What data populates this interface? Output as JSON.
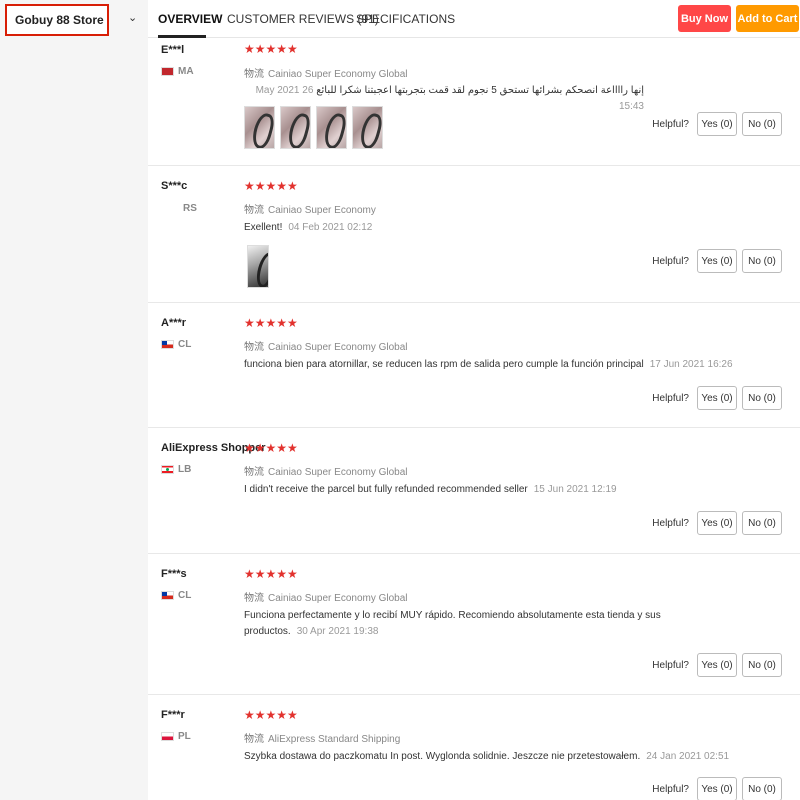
{
  "store": {
    "name": "Gobuy 88 Store",
    "chevron_icon": "chevron-down-icon"
  },
  "nav": {
    "tabs": [
      {
        "label": "OVERVIEW",
        "active": true
      },
      {
        "label": "CUSTOMER REVIEWS (91)",
        "active": false
      },
      {
        "label": "SPECIFICATIONS",
        "active": false
      }
    ],
    "buy_now": "Buy Now",
    "add_to_cart": "Add to Cart",
    "colors": {
      "buy_now": "#ff4747",
      "add_to_cart": "#ff9a00",
      "star": "#e2322e"
    }
  },
  "reviews": [
    {
      "name": "E***l",
      "country": "MA",
      "stars": "★★★★★",
      "logistics_label": "物流",
      "logistics": "Cainiao Super Economy Global",
      "text": "إنها رااااعة انصحكم بشرائها تستحق 5 نجوم لقد قمت بتجربتها اعجبتنا شكرا للبائع",
      "date": "26 May 2021 15:43",
      "photos": 4,
      "yes": "Yes (0)",
      "no": "No (0)",
      "helpful": "Helpful?"
    },
    {
      "name": "S***c",
      "country": "RS",
      "stars": "★★★★★",
      "logistics_label": "物流",
      "logistics": "Cainiao Super Economy",
      "text": "Exellent!",
      "date": "04 Feb 2021 02:12",
      "photos": 1,
      "yes": "Yes (0)",
      "no": "No (0)",
      "helpful": "Helpful?"
    },
    {
      "name": "A***r",
      "country": "CL",
      "stars": "★★★★★",
      "logistics_label": "物流",
      "logistics": "Cainiao Super Economy Global",
      "text": "funciona bien para atornillar, se reducen las rpm de salida pero cumple la función principal",
      "date": "17 Jun 2021 16:26",
      "photos": 0,
      "yes": "Yes (0)",
      "no": "No (0)",
      "helpful": "Helpful?"
    },
    {
      "name": "AliExpress Shopper",
      "country": "LB",
      "stars": "★★★★★",
      "logistics_label": "物流",
      "logistics": "Cainiao Super Economy Global",
      "text": "I didn't receive the parcel but fully refunded recommended seller",
      "date": "15 Jun 2021 12:19",
      "photos": 0,
      "yes": "Yes (0)",
      "no": "No (0)",
      "helpful": "Helpful?"
    },
    {
      "name": "F***s",
      "country": "CL",
      "stars": "★★★★★",
      "logistics_label": "物流",
      "logistics": "Cainiao Super Economy Global",
      "text": "Funciona perfectamente y lo recibí MUY rápido. Recomiendo absolutamente esta tienda y sus productos.",
      "date": "30 Apr 2021 19:38",
      "photos": 0,
      "yes": "Yes (0)",
      "no": "No (0)",
      "helpful": "Helpful?"
    },
    {
      "name": "F***r",
      "country": "PL",
      "stars": "★★★★★",
      "logistics_label": "物流",
      "logistics": "AliExpress Standard Shipping",
      "text": "Szybka dostawa do paczkomatu In post. Wyglonda solidnie. Jeszcze nie przetestowałem.",
      "date": "24 Jan 2021 02:51",
      "photos": 0,
      "yes": "Yes (0)",
      "no": "No (0)",
      "helpful": "Helpful?"
    }
  ]
}
